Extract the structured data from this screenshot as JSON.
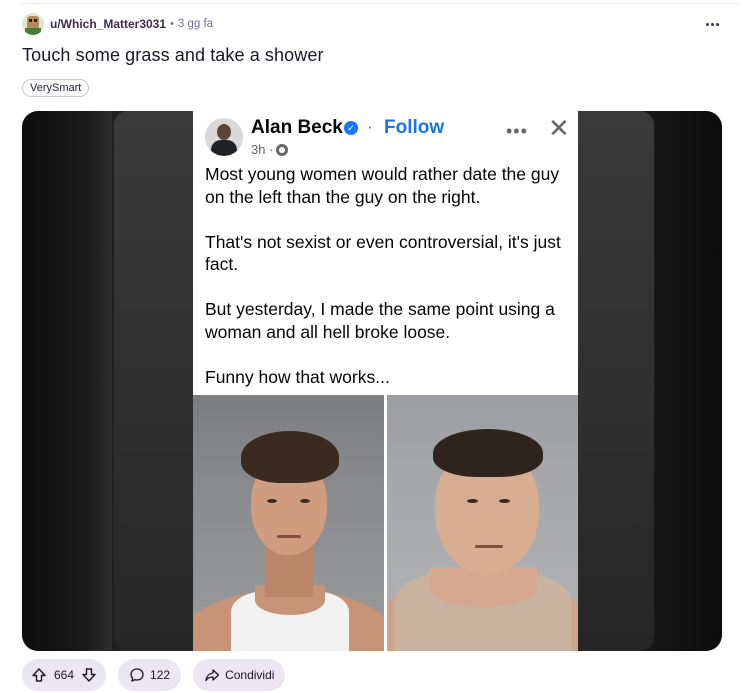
{
  "post": {
    "author": "u/Which_Matter3031",
    "time": "3 gg fa",
    "separator": "•",
    "title": "Touch some grass and take a shower",
    "flair": "VerySmart"
  },
  "embedded": {
    "name": "Alan Beck",
    "verified_mark": "✓",
    "separator": "·",
    "follow": "Follow",
    "time": "3h ·",
    "more": "•••",
    "close": "✕",
    "paragraphs": [
      "Most young women would rather date the guy on the left than the guy on the right.",
      "That's not sexist or even controversial, it's just fact.",
      "But yesterday, I made the same point using a woman and all hell broke loose.",
      "Funny how that works..."
    ]
  },
  "actions": {
    "votes": "664",
    "comments": "122",
    "share": "Condividi"
  },
  "colors": {
    "accent_pill": "#ece6f2",
    "username": "#3b2f52",
    "follow_blue": "#1b74e4"
  }
}
